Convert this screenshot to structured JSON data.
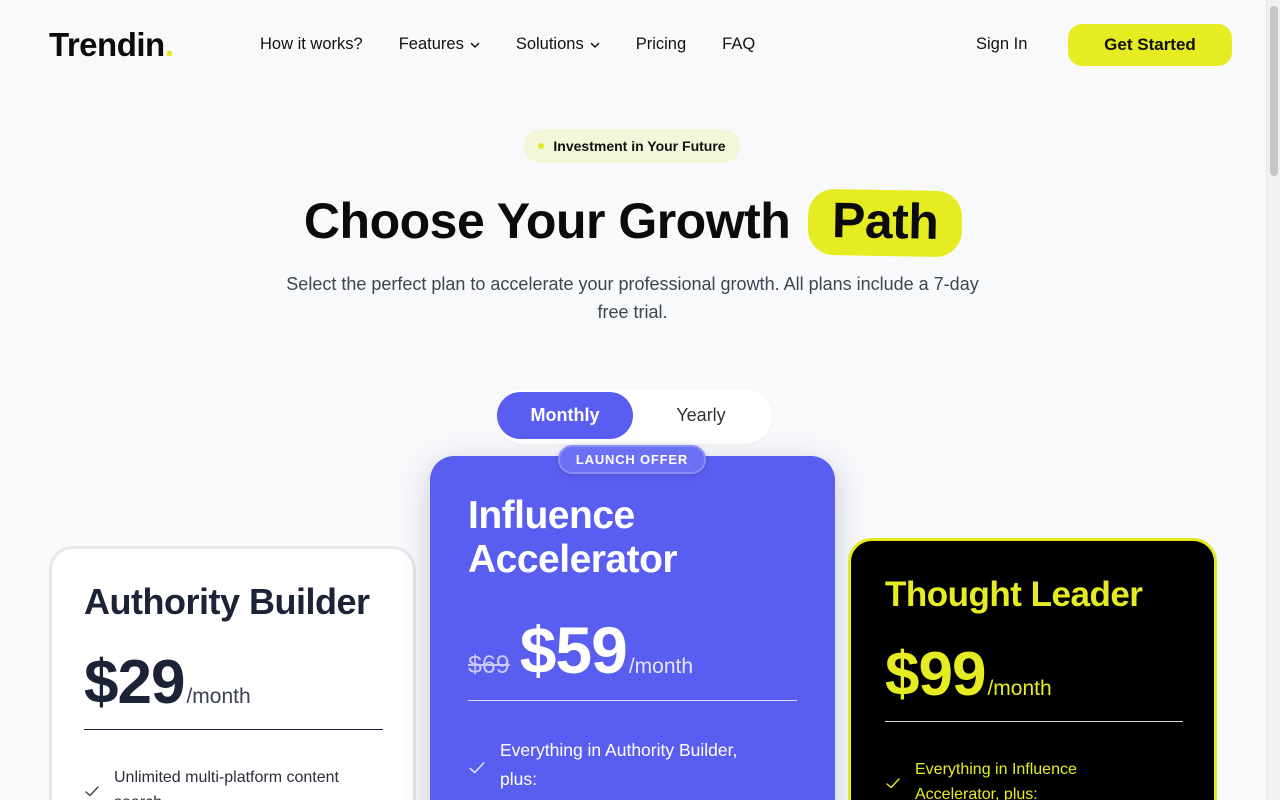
{
  "header": {
    "logo_text": "Trendin",
    "logo_dot": ".",
    "nav": [
      {
        "label": "How it works?",
        "has_dropdown": false
      },
      {
        "label": "Features",
        "has_dropdown": true
      },
      {
        "label": "Solutions",
        "has_dropdown": true
      },
      {
        "label": "Pricing",
        "has_dropdown": false
      },
      {
        "label": "FAQ",
        "has_dropdown": false
      }
    ],
    "sign_in": "Sign In",
    "get_started": "Get Started"
  },
  "hero": {
    "badge": "Investment in Your Future",
    "title_main": "Choose Your Growth",
    "title_highlight": "Path",
    "subtitle": "Select the perfect plan to accelerate your professional growth. All plans include a 7-day free trial."
  },
  "billing_toggle": {
    "options": [
      "Monthly",
      "Yearly"
    ],
    "selected": "Monthly"
  },
  "plans": [
    {
      "name": "Authority Builder",
      "price": "$29",
      "period": "/month",
      "features": [
        "Unlimited multi-platform content search"
      ]
    },
    {
      "badge": "LAUNCH OFFER",
      "name": "Influence Accelerator",
      "old_price": "$69",
      "price": "$59",
      "period": "/month",
      "features": [
        "Everything in Authority Builder, plus:"
      ]
    },
    {
      "name": "Thought Leader",
      "price": "$99",
      "period": "/month",
      "features": [
        "Everything in Influence Accelerator, plus:"
      ]
    }
  ],
  "colors": {
    "accent_yellow": "#e6ec22",
    "accent_purple": "#5a5ef0",
    "background": "#f8f9fb",
    "dark": "#000000"
  }
}
